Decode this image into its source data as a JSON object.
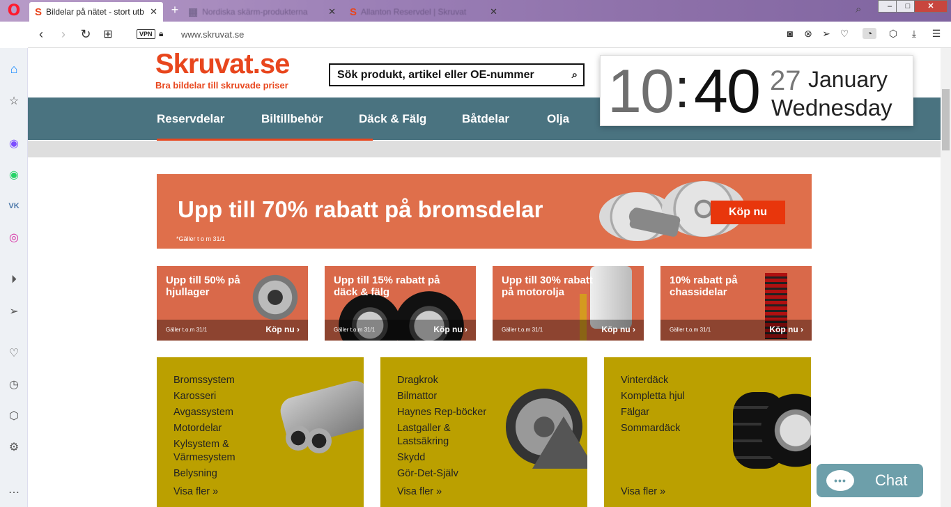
{
  "browser": {
    "tabs": [
      {
        "title": "Bildelar på nätet - stort utb",
        "favicon": "S",
        "active": true
      },
      {
        "title": "Nordiska skärm-produkterna",
        "favicon": "",
        "active": false
      },
      {
        "title": "Allanton Reservdel | Skruvat",
        "favicon": "S",
        "active": false
      }
    ],
    "new_tab": "+",
    "address": {
      "vpn": "VPN",
      "url": "www.skruvat.se"
    },
    "window_controls": {
      "minimize": "–",
      "maximize": "□",
      "close": "✕"
    }
  },
  "site": {
    "logo": "Skruvat.se",
    "tagline": "Bra bildelar till skruvade priser",
    "search_placeholder": "Sök produkt, artikel eller OE-nummer",
    "nav": [
      "Reservdelar",
      "Biltillbehör",
      "Däck & Fälg",
      "Båtdelar",
      "Olja"
    ],
    "hero": {
      "title": "Upp till 70% rabatt på bromsdelar",
      "note": "*Gäller t o m 31/1",
      "button": "Köp nu"
    },
    "promos": [
      {
        "title": "Upp till 50% på hjullager",
        "valid": "Gäller t.o.m 31/1",
        "cta": "Köp nu"
      },
      {
        "title": "Upp till 15% rabatt på däck & fälg",
        "valid": "Gäller t.o.m 31/1",
        "cta": "Köp nu"
      },
      {
        "title": "Upp till 30% rabatt på motorolja",
        "valid": "Gäller t.o.m 31/1",
        "cta": "Köp nu"
      },
      {
        "title": "10% rabatt på chassidelar",
        "valid": "Gäller t.o.m 31/1",
        "cta": "Köp nu"
      }
    ],
    "categories": [
      {
        "items": [
          "Bromssystem",
          "Karosseri",
          "Avgassystem",
          "Motordelar",
          "Kylsystem &",
          "Värmesystem",
          "Belysning"
        ],
        "more": "Visa fler »"
      },
      {
        "items": [
          "Dragkrok",
          "Bilmattor",
          "Haynes Rep-böcker",
          "Lastgaller &",
          "Lastsäkring",
          "Skydd",
          "Gör-Det-Själv"
        ],
        "more": "Visa fler »"
      },
      {
        "items": [
          "Vinterdäck",
          "Kompletta hjul",
          "Fälgar",
          "Sommardäck"
        ],
        "more": "Visa fler »"
      }
    ],
    "chat": "Chat"
  },
  "clock": {
    "hour": "10",
    "colon": ":",
    "minute": "40",
    "day": "27",
    "month": "January",
    "weekday": "Wednesday"
  },
  "colors": {
    "brand": "#e8461d",
    "nav": "#4a7380",
    "category": "#bba000",
    "chat": "#6d9faa"
  }
}
